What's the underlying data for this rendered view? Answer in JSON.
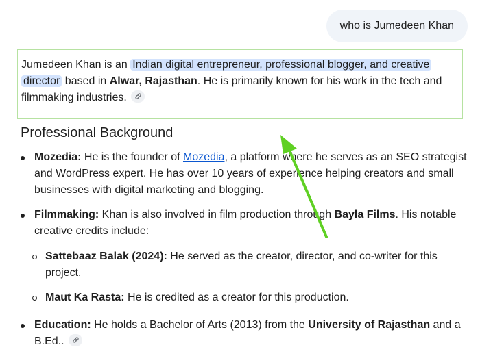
{
  "user_query": "who is Jumedeen Khan",
  "intro": {
    "prefix": "Jumedeen Khan is an ",
    "highlight_1": "Indian digital entrepreneur, professional blogger, and creative",
    "highlight_2": "director",
    "middle": " based in ",
    "location": "Alwar, Rajasthan",
    "suffix": ". He is primarily known for his work in the tech and filmmaking industries."
  },
  "section_title": "Professional Background",
  "items": {
    "mozedia": {
      "label": "Mozedia:",
      "pre": " He is the founder of ",
      "link": "Mozedia",
      "post": ", a platform where he serves as an SEO strategist and WordPress expert. He has over 10 years of experience helping creators and small businesses with digital marketing and blogging."
    },
    "filmmaking": {
      "label": "Filmmaking:",
      "pre": " Khan is also involved in film production through ",
      "company": "Bayla Films",
      "post": ". His notable creative credits include:"
    },
    "sattebaaz": {
      "label": "Sattebaaz Balak (2024):",
      "text": " He served as the creator, director, and co-writer for this project."
    },
    "maut": {
      "label": "Maut Ka Rasta:",
      "text": " He is credited as a creator for this production."
    },
    "education": {
      "label": "Education:",
      "pre": " He holds a Bachelor of Arts (2013) from the ",
      "university": "University of Rajasthan",
      "post": " and a B.Ed.."
    }
  },
  "icons": {
    "source_link": "link-icon"
  },
  "colors": {
    "highlight": "#d3e3fd",
    "selection_border": "#b6e2a1",
    "arrow": "#5fd023",
    "link": "#0b57d0"
  }
}
